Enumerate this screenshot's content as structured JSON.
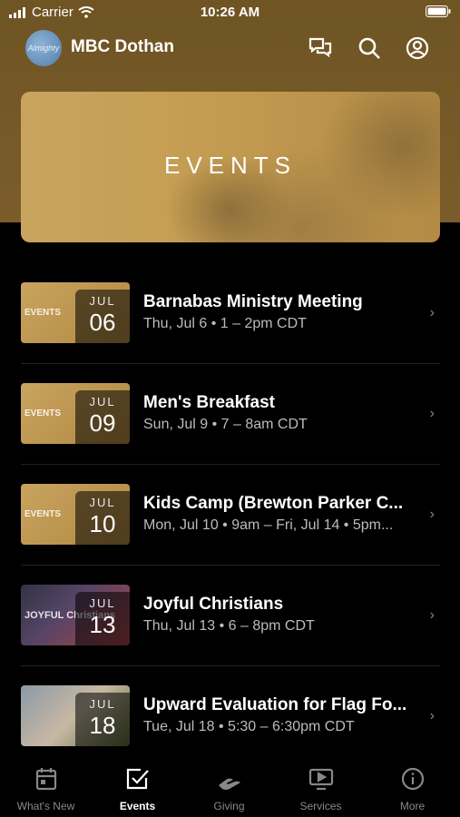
{
  "status": {
    "carrier": "Carrier",
    "time": "10:26 AM"
  },
  "header": {
    "title": "MBC Dothan",
    "avatar_text": "Almighty"
  },
  "banner": {
    "title": "EVENTS"
  },
  "events": [
    {
      "month": "JUL",
      "day": "06",
      "title": "Barnabas Ministry Meeting",
      "time": "Thu, Jul 6 • 1 – 2pm CDT",
      "thumb_label": "EVENTS"
    },
    {
      "month": "JUL",
      "day": "09",
      "title": "Men's Breakfast",
      "time": "Sun, Jul 9 • 7 – 8am CDT",
      "thumb_label": "EVENTS"
    },
    {
      "month": "JUL",
      "day": "10",
      "title": "Kids Camp (Brewton Parker C...",
      "time": "Mon, Jul 10 • 9am – Fri, Jul 14 • 5pm...",
      "thumb_label": "EVENTS"
    },
    {
      "month": "JUL",
      "day": "13",
      "title": "Joyful Christians",
      "time": "Thu, Jul 13 • 6 – 8pm CDT",
      "thumb_label": "JOYFUL Christians"
    },
    {
      "month": "JUL",
      "day": "18",
      "title": "Upward Evaluation for Flag Fo...",
      "time": "Tue, Jul 18 • 5:30 – 6:30pm CDT",
      "thumb_label": ""
    }
  ],
  "tabs": [
    {
      "label": "What's New",
      "icon": "calendar-icon"
    },
    {
      "label": "Events",
      "icon": "checkbox-icon"
    },
    {
      "label": "Giving",
      "icon": "giving-icon"
    },
    {
      "label": "Services",
      "icon": "tv-play-icon"
    },
    {
      "label": "More",
      "icon": "info-icon"
    }
  ],
  "colors": {
    "header": "#7a5d2a",
    "banner": "#c59d52",
    "background": "#000000"
  }
}
